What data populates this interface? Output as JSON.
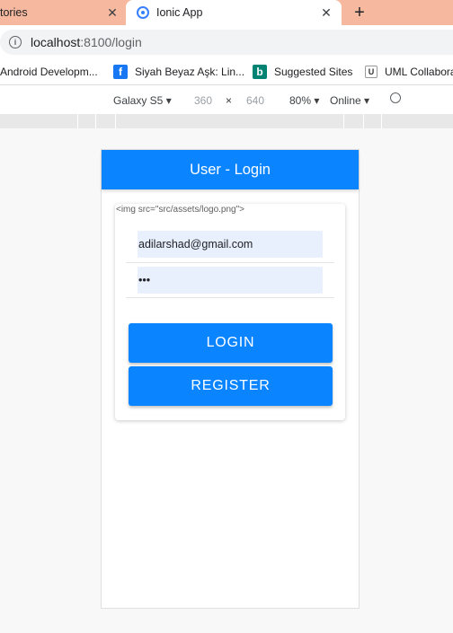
{
  "browser": {
    "prev_tab_label": "tories",
    "active_tab_label": "Ionic App",
    "url_host": "localhost",
    "url_path": ":8100/login",
    "new_tab_symbol": "+",
    "close_symbol": "✕"
  },
  "bookmarks": [
    {
      "label": "Android Developm..."
    },
    {
      "label": "Siyah Beyaz Aşk: Lin...",
      "icon": "facebook-icon"
    },
    {
      "label": "Suggested Sites",
      "icon": "bing-icon"
    },
    {
      "label": "UML Collabora",
      "icon": "uml-icon"
    }
  ],
  "device_toolbar": {
    "device": "Galaxy S5",
    "width": "360",
    "times": "×",
    "height": "640",
    "zoom": "80%",
    "network": "Online"
  },
  "app": {
    "header_title": "User - Login",
    "logo_alt": "<img src=\"src/assets/logo.png\">",
    "email_value": "adilarshad@gmail.com",
    "password_value": "•••",
    "login_label": "LOGIN",
    "register_label": "REGISTER"
  },
  "colors": {
    "tab_strip": "#f6b9a0",
    "ionic_primary": "#0a84ff",
    "autofill_bg": "#e8f0fe"
  }
}
